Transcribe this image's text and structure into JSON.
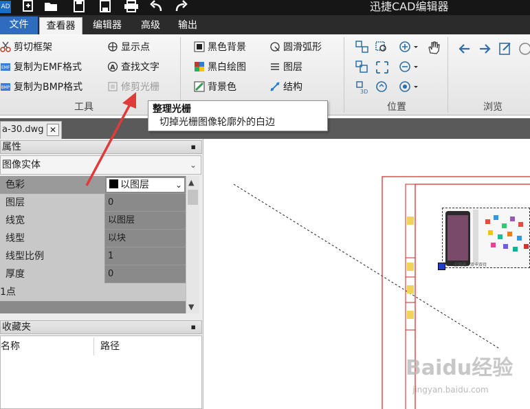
{
  "titlebar": {
    "logo": "AD",
    "title": "迅捷CAD编辑器",
    "quick_access": [
      "new-icon",
      "open-icon",
      "save-icon",
      "save-as-icon",
      "print-icon",
      "undo-icon",
      "redo-icon"
    ]
  },
  "tabs": [
    {
      "label": "文件"
    },
    {
      "label": "查看器"
    },
    {
      "label": "编辑器"
    },
    {
      "label": "高级"
    },
    {
      "label": "输出"
    }
  ],
  "ribbon": {
    "tools": {
      "label": "工具",
      "col1": [
        "剪切框架",
        "复制为EMF格式",
        "复制为BMP格式"
      ],
      "col2": [
        "显示点",
        "查找文字",
        "修剪光栅"
      ]
    },
    "display": {
      "col1": [
        "黑色背景",
        "黑白绘图",
        "背景色"
      ],
      "col2": [
        "圆滑弧形",
        "图层",
        "结构"
      ]
    },
    "position": {
      "label": "位置"
    },
    "browse": {
      "label": "浏览"
    }
  },
  "tooltip": {
    "title": "整理光栅",
    "body": "切掉光栅图像轮廓外的白边"
  },
  "doc_tab": {
    "name": "a-30.dwg",
    "close": "✕"
  },
  "properties": {
    "header": "属性",
    "object_type": "图像实体",
    "rows": [
      {
        "name": "色彩",
        "value": "以图层"
      },
      {
        "name": "图层",
        "value": "0"
      },
      {
        "name": "线宽",
        "value": "以图层"
      },
      {
        "name": "线型",
        "value": "以块"
      },
      {
        "name": "线型比例",
        "value": "1"
      },
      {
        "name": "厚度",
        "value": "0"
      },
      {
        "name": "1点",
        "value": ""
      }
    ]
  },
  "favorites": {
    "header": "收藏夹",
    "columns": [
      "名称",
      "路径"
    ]
  },
  "canvas": {
    "image_caption": "全网通，双卡双待",
    "watermark": "Baidu经验",
    "watermark_sub": "jingyan.baidu.com"
  },
  "colors": {
    "accent": "#2f6bbf",
    "drawing_red": "#d42020",
    "arrow_red": "#e03a3a"
  }
}
